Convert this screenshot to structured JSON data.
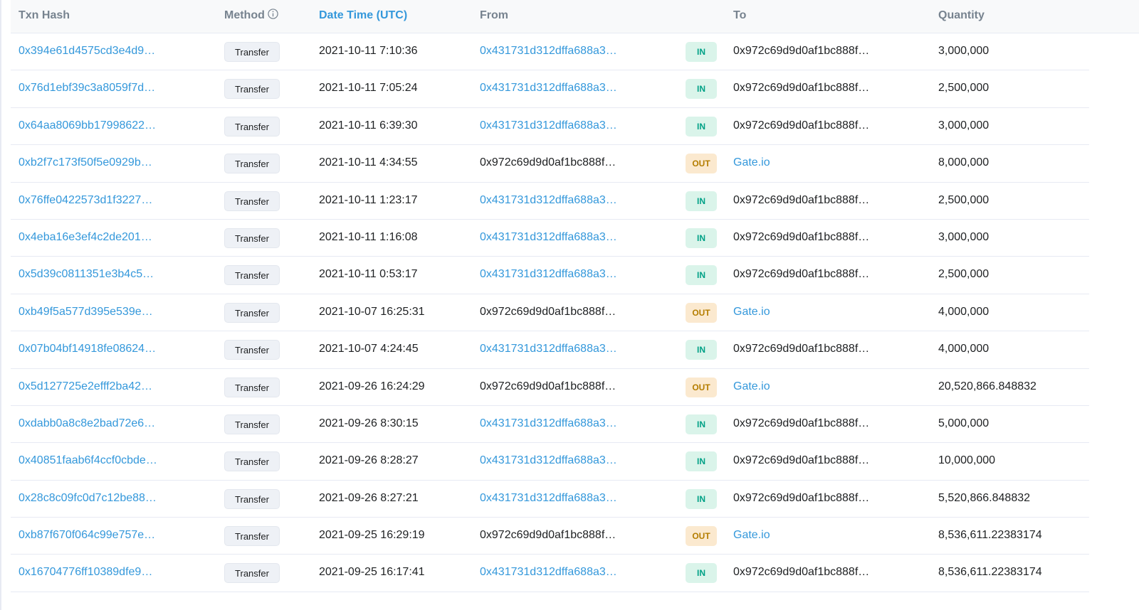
{
  "header": {
    "txn_hash": "Txn Hash",
    "method": "Method",
    "date_time": "Date Time (UTC)",
    "from": "From",
    "to": "To",
    "quantity": "Quantity"
  },
  "colors": {
    "link": "#3498db",
    "in_bg": "#daf4ea",
    "in_text": "#00a186",
    "out_bg": "#fbe9cf",
    "out_text": "#b47d00"
  },
  "rows": [
    {
      "hash": "0x394e61d4575cd3e4d9…",
      "method": "Transfer",
      "date": "2021-10-11 7:10:36",
      "from": "0x431731d312dffa688a3…",
      "from_link": true,
      "dir": "IN",
      "to": "0x972c69d9d0af1bc888f…",
      "to_link": false,
      "qty": "3,000,000"
    },
    {
      "hash": "0x76d1ebf39c3a8059f7d…",
      "method": "Transfer",
      "date": "2021-10-11 7:05:24",
      "from": "0x431731d312dffa688a3…",
      "from_link": true,
      "dir": "IN",
      "to": "0x972c69d9d0af1bc888f…",
      "to_link": false,
      "qty": "2,500,000"
    },
    {
      "hash": "0x64aa8069bb17998622…",
      "method": "Transfer",
      "date": "2021-10-11 6:39:30",
      "from": "0x431731d312dffa688a3…",
      "from_link": true,
      "dir": "IN",
      "to": "0x972c69d9d0af1bc888f…",
      "to_link": false,
      "qty": "3,000,000"
    },
    {
      "hash": "0xb2f7c173f50f5e0929b…",
      "method": "Transfer",
      "date": "2021-10-11 4:34:55",
      "from": "0x972c69d9d0af1bc888f…",
      "from_link": false,
      "dir": "OUT",
      "to": "Gate.io",
      "to_link": true,
      "qty": "8,000,000"
    },
    {
      "hash": "0x76ffe0422573d1f3227…",
      "method": "Transfer",
      "date": "2021-10-11 1:23:17",
      "from": "0x431731d312dffa688a3…",
      "from_link": true,
      "dir": "IN",
      "to": "0x972c69d9d0af1bc888f…",
      "to_link": false,
      "qty": "2,500,000"
    },
    {
      "hash": "0x4eba16e3ef4c2de201…",
      "method": "Transfer",
      "date": "2021-10-11 1:16:08",
      "from": "0x431731d312dffa688a3…",
      "from_link": true,
      "dir": "IN",
      "to": "0x972c69d9d0af1bc888f…",
      "to_link": false,
      "qty": "3,000,000"
    },
    {
      "hash": "0x5d39c0811351e3b4c5…",
      "method": "Transfer",
      "date": "2021-10-11 0:53:17",
      "from": "0x431731d312dffa688a3…",
      "from_link": true,
      "dir": "IN",
      "to": "0x972c69d9d0af1bc888f…",
      "to_link": false,
      "qty": "2,500,000"
    },
    {
      "hash": "0xb49f5a577d395e539e…",
      "method": "Transfer",
      "date": "2021-10-07 16:25:31",
      "from": "0x972c69d9d0af1bc888f…",
      "from_link": false,
      "dir": "OUT",
      "to": "Gate.io",
      "to_link": true,
      "qty": "4,000,000"
    },
    {
      "hash": "0x07b04bf14918fe08624…",
      "method": "Transfer",
      "date": "2021-10-07 4:24:45",
      "from": "0x431731d312dffa688a3…",
      "from_link": true,
      "dir": "IN",
      "to": "0x972c69d9d0af1bc888f…",
      "to_link": false,
      "qty": "4,000,000"
    },
    {
      "hash": "0x5d127725e2efff2ba42…",
      "method": "Transfer",
      "date": "2021-09-26 16:24:29",
      "from": "0x972c69d9d0af1bc888f…",
      "from_link": false,
      "dir": "OUT",
      "to": "Gate.io",
      "to_link": true,
      "qty": "20,520,866.848832"
    },
    {
      "hash": "0xdabb0a8c8e2bad72e6…",
      "method": "Transfer",
      "date": "2021-09-26 8:30:15",
      "from": "0x431731d312dffa688a3…",
      "from_link": true,
      "dir": "IN",
      "to": "0x972c69d9d0af1bc888f…",
      "to_link": false,
      "qty": "5,000,000"
    },
    {
      "hash": "0x40851faab6f4ccf0cbde…",
      "method": "Transfer",
      "date": "2021-09-26 8:28:27",
      "from": "0x431731d312dffa688a3…",
      "from_link": true,
      "dir": "IN",
      "to": "0x972c69d9d0af1bc888f…",
      "to_link": false,
      "qty": "10,000,000"
    },
    {
      "hash": "0x28c8c09fc0d7c12be88…",
      "method": "Transfer",
      "date": "2021-09-26 8:27:21",
      "from": "0x431731d312dffa688a3…",
      "from_link": true,
      "dir": "IN",
      "to": "0x972c69d9d0af1bc888f…",
      "to_link": false,
      "qty": "5,520,866.848832"
    },
    {
      "hash": "0xb87f670f064c99e757e…",
      "method": "Transfer",
      "date": "2021-09-25 16:29:19",
      "from": "0x972c69d9d0af1bc888f…",
      "from_link": false,
      "dir": "OUT",
      "to": "Gate.io",
      "to_link": true,
      "qty": "8,536,611.22383174"
    },
    {
      "hash": "0x16704776ff10389dfe9…",
      "method": "Transfer",
      "date": "2021-09-25 16:17:41",
      "from": "0x431731d312dffa688a3…",
      "from_link": true,
      "dir": "IN",
      "to": "0x972c69d9d0af1bc888f…",
      "to_link": false,
      "qty": "8,536,611.22383174"
    }
  ]
}
